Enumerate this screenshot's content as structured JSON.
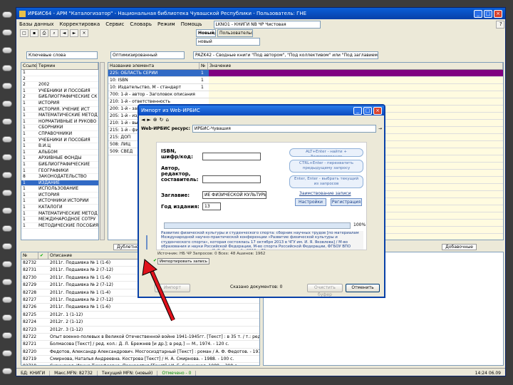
{
  "app": {
    "title": "ИРБИС64 - АРМ \"Каталогизатор\" - Национальная библиотека Чувашской Республики - Пользователь: ГНЕ",
    "menu": [
      "Базы данных",
      "Корректировка",
      "Сервис",
      "Словарь",
      "Режим",
      "Помощь"
    ],
    "db_field": "LKNO1 - КНИГИ NB ЧР Чистовая",
    "tab_new": "Новый/ИРН",
    "tab_current": "Пользовательские",
    "current_value": "новый",
    "search_mode": "Ключевые слова",
    "worksheet": "Оптимизированный",
    "worksheet_desc": "PAZK42 - Сводные книги \"Под автором\", \"Под коллективом\" или \"Под заглавием\"",
    "status": [
      "БД: КНИГИ",
      "Макс.MFN: 82732",
      "Текущий MFN: (новый)",
      "Отмечено - 0"
    ],
    "time": "14:24  06.09"
  },
  "dictionary": {
    "col_freq": "Ссылок",
    "col_term": "Термин",
    "rows": [
      {
        "f": "1",
        "t": ""
      },
      {
        "f": "2",
        "t": ""
      },
      {
        "f": "2",
        "t": "2002"
      },
      {
        "f": "1",
        "t": "УЧЕБНИКИ И ПОСОБИЯ"
      },
      {
        "f": "2",
        "t": "БИБЛИОГРАФИЧЕСКИЕ СК"
      },
      {
        "f": "1",
        "t": "ИСТОРИЯ"
      },
      {
        "f": "1",
        "t": "ИСТОРИЯ. УЧЕНИЕ ИСТ"
      },
      {
        "f": "1",
        "t": "МАТЕМАТИЧЕСКИЕ МЕТОД"
      },
      {
        "f": "1",
        "t": "НОРМАТИВНЫЕ И РУКОВО"
      },
      {
        "f": "1",
        "t": "СБОРНИКИ"
      },
      {
        "f": "1",
        "t": "СПРАВОЧНИКИ"
      },
      {
        "f": "1",
        "t": "УЧЕБНИКИ И ПОСОБИЯ"
      },
      {
        "f": "1",
        "t": "В.И.Ц"
      },
      {
        "f": "1",
        "t": "АЛЬБОМ"
      },
      {
        "f": "1",
        "t": "АРХИВНЫЕ ФОНДЫ"
      },
      {
        "f": "1",
        "t": "БИБЛИОГРАФИЧЕСКИЕ"
      },
      {
        "f": "1",
        "t": "ГЕОГРАФИКИ"
      },
      {
        "f": "8",
        "t": "ЗАКОНОДАТЕЛЬСТВО"
      },
      {
        "f": "1",
        "t": "ИЗДАНИЕ"
      },
      {
        "f": "1",
        "t": "ИСПОЛЬЗОВАНИЕ"
      },
      {
        "f": "1",
        "t": "ИСТОРИЯ"
      },
      {
        "f": "1",
        "t": "ИСТОЧНИКИ ИСТОРИИ"
      },
      {
        "f": "1",
        "t": "КАТАЛОГИ"
      },
      {
        "f": "1",
        "t": "МАТЕМАТИЧЕСКИЕ МЕТОД"
      },
      {
        "f": "1",
        "t": "МЕЖДУНАРОДНОЕ СОТРУ"
      },
      {
        "f": "1",
        "t": "МЕТОДИЧЕСКИЕ ПОСОБИЯ"
      }
    ],
    "selected_index": 18
  },
  "fields": {
    "col_name": "Название элемента",
    "col_num": "№",
    "col_value": "Значение",
    "rows": [
      {
        "n": "225: ОБЛАСТЬ СЕРИИ",
        "v": "1"
      },
      {
        "n": "10: ISBN",
        "v": "1"
      },
      {
        "n": "10: Издательство, М - стандарт",
        "v": "1"
      },
      {
        "n": "700: 1-й - автор - Заголовок описания",
        "v": ""
      },
      {
        "n": "210: 1-й - ответственность",
        "v": ""
      },
      {
        "n": "200: 1-й - заглавие",
        "v": ""
      },
      {
        "n": "205: 1-й - издание",
        "v": ""
      },
      {
        "n": "210: 1-й - выходные данные",
        "v": ""
      },
      {
        "n": "215: 1-й - физическая характеристика",
        "v": ""
      },
      {
        "n": "215: ДОП",
        "v": ""
      },
      {
        "n": "508: ЛИЦ",
        "v": ""
      },
      {
        "n": "509: СВЕД",
        "v": ""
      }
    ]
  },
  "bottom_tabs": [
    "Дублетность",
    "Добавочные"
  ],
  "bottom_list": {
    "col_mfn": "№",
    "col_desc": "Описание",
    "rows": [
      {
        "m": "82732",
        "d": "2011г. Подшивка № 1 (1-6)"
      },
      {
        "m": "82731",
        "d": "2011г. Подшивка № 2 (7-12)"
      },
      {
        "m": "82730",
        "d": "2011г. Подшивка № 1 (1-6)"
      },
      {
        "m": "82729",
        "d": "2011г. Подшивка № 2 (7-12)"
      },
      {
        "m": "82728",
        "d": "2011г. Подшивка № 1 (1-4)"
      },
      {
        "m": "82727",
        "d": "2011г. Подшивка № 2 (7-12)"
      },
      {
        "m": "82726",
        "d": "2011г. Подшивка № 1 (1-6)"
      },
      {
        "m": "82725",
        "d": "2012г. 1 (1-12)"
      },
      {
        "m": "82724",
        "d": "2012г. 2 (1-12)"
      },
      {
        "m": "82723",
        "d": "2012г. 3 (1-12)"
      },
      {
        "m": "82722",
        "d": "Опыт военно-полевых в Великой Отечественной войне 1941-1945гг. [Текст] : в 35 т. / т.: ред. Е. И. Смир"
      },
      {
        "m": "82721",
        "d": "Болмасова [Текст] / ред. кол.: Д. Л. Брежнев [и др.]; в ред.] — М., 1974. - 120 с."
      },
      {
        "m": "82720",
        "d": "Федотов, Александр Александрович. Мосгосиздтарный [Текст] : роман / А. Ф. Федотов. - 1974. - 251 с."
      },
      {
        "m": "82719",
        "d": "Смирнова, Наталья Андреевна. Кострова [Текст] / Н. А. Смирнова. - 1988. - 100 с."
      },
      {
        "m": "82718",
        "d": "Сизинская. Ирина Тимофеевна. Прокрастия [Текст] / И. Г. Сизинская. 1988. - 398 с."
      },
      {
        "m": "82717",
        "d": "Смирнов, Виктор Васильевич. Зарница [Текст] : повесть / В. В. Смирнов, 1986. - 98 с."
      },
      {
        "m": "82716",
        "d": "Эльнейдер, Инна Григорьевна. Необычайные похождения правил древней [Текст] / И. Г. Эльнейдер, 1986"
      }
    ]
  },
  "dialog": {
    "title": "Импорт из Web-ИРБИС",
    "address_label": "Web-ИРБИС ресурс:",
    "address_value": "ИРБИС-Чувашия",
    "labels": {
      "isbn": "ISBN, шифр/код:",
      "author": "Автор, редактор, составитель:",
      "title": "Заглавие:",
      "year": "Год издания:"
    },
    "values": {
      "isbn": "",
      "author": "",
      "title": "ИЕ ФИЗИЧЕСКОЙ КУЛЬТУРЫ",
      "year": "13"
    },
    "hints": [
      "ALT+Enter - найти + Заимствование",
      "CTRL+Enter - перехватить предыдущему запросу",
      "Enter, Enter - выбрать текущий из запросов"
    ],
    "import_link": "Заимствование записи",
    "btn_settings": "Настройки",
    "btn_register": "Регистрация",
    "progress_label": "100%",
    "progress": 1.0,
    "abstract": "Развитие физической культуры и студенческого спорта: сборник научных трудов [по материалам Международной научно-практической конференции «Развитие физической культуры и студенческого спорта», которая состоялась 17 октября 2013 в ЧГУ им. И. Я. Яковлева] / М-во образования и науки Российской Федерации, М-во спорта Российской Федерации, ФГБОУ ВПО Чуваш. гос. пед. ун-т им. И. Я. Яковлева\" - 2013. - 79 с.",
    "status_line": "Источник: НБ ЧР  Запросов: 0  Всех: 48  Ашинов: 1962",
    "import_button_label": "Импортировать запись",
    "found_label": "Сказано документов: 0",
    "btn_import": "Импорт",
    "btn_clear": "Очистить буфер",
    "btn_close": "Отменить"
  },
  "colors": {
    "selection": "#316ac5",
    "field_highlight": "#800080",
    "xp_blue": "#0840a8",
    "arrow": "#e0121c",
    "abstract_text": "#1a3f88"
  }
}
